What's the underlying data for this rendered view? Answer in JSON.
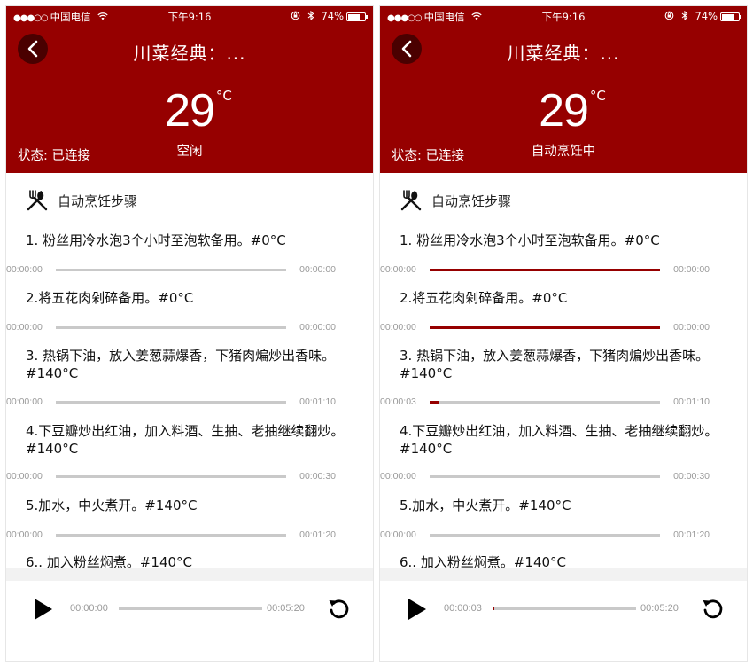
{
  "colors": {
    "accent": "#960000",
    "back_button_bg": "#4a0000",
    "track": "#c9c9c9"
  },
  "screens": [
    {
      "status_bar": {
        "signal": "●●●○○",
        "carrier": "中国电信",
        "wifi": "wifi-icon",
        "time": "下午9:16",
        "battery": "74%"
      },
      "title": "川菜经典：...",
      "temperature": "29",
      "temp_unit": "°C",
      "state": "状态: 已连接",
      "mode": "空闲",
      "steps_heading": "自动烹饪步骤",
      "steps": [
        {
          "text": "1. 粉丝用冷水泡3个小时至泡软备用。#0°C",
          "elapsed": "00:00:00",
          "total": "00:00:00",
          "progress": 0
        },
        {
          "text": "2.将五花肉剁碎备用。#0°C",
          "elapsed": "00:00:00",
          "total": "00:00:00",
          "progress": 0
        },
        {
          "text": "3. 热锅下油，放入姜葱蒜爆香，下猪肉煸炒出香味。#140°C",
          "elapsed": "00:00:00",
          "total": "00:01:10",
          "progress": 0
        },
        {
          "text": "4.下豆瓣炒出红油，加入料酒、生抽、老抽继续翻炒。#140°C",
          "elapsed": "00:00:00",
          "total": "00:00:30",
          "progress": 0
        },
        {
          "text": "5.加水，中火煮开。#140°C",
          "elapsed": "00:00:00",
          "total": "00:01:20",
          "progress": 0
        },
        {
          "text": "6.. 加入粉丝焖煮。#140°C"
        }
      ],
      "player": {
        "elapsed": "00:00:00",
        "total": "00:05:20",
        "progress": 0
      }
    },
    {
      "status_bar": {
        "signal": "●●●○○",
        "carrier": "中国电信",
        "wifi": "wifi-icon",
        "time": "下午9:16",
        "battery": "74%"
      },
      "title": "川菜经典：...",
      "temperature": "29",
      "temp_unit": "°C",
      "state": "状态: 已连接",
      "mode": "自动烹饪中",
      "steps_heading": "自动烹饪步骤",
      "steps": [
        {
          "text": "1. 粉丝用冷水泡3个小时至泡软备用。#0°C",
          "elapsed": "00:00:00",
          "total": "00:00:00",
          "progress": 1
        },
        {
          "text": "2.将五花肉剁碎备用。#0°C",
          "elapsed": "00:00:00",
          "total": "00:00:00",
          "progress": 1
        },
        {
          "text": "3. 热锅下油，放入姜葱蒜爆香，下猪肉煸炒出香味。#140°C",
          "elapsed": "00:00:03",
          "total": "00:01:10",
          "progress": 0.04
        },
        {
          "text": "4.下豆瓣炒出红油，加入料酒、生抽、老抽继续翻炒。#140°C",
          "elapsed": "00:00:00",
          "total": "00:00:30",
          "progress": 0
        },
        {
          "text": "5.加水，中火煮开。#140°C",
          "elapsed": "00:00:00",
          "total": "00:01:20",
          "progress": 0
        },
        {
          "text": "6.. 加入粉丝焖煮。#140°C"
        }
      ],
      "player": {
        "elapsed": "00:00:03",
        "total": "00:05:20",
        "progress": 0.01
      }
    }
  ]
}
